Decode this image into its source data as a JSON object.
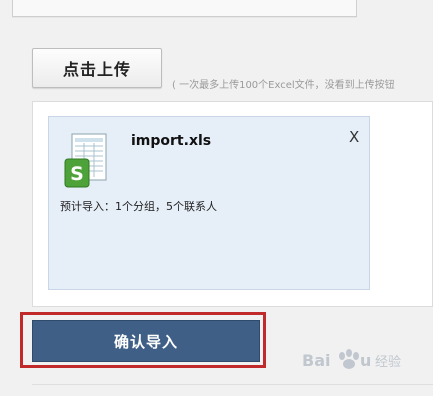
{
  "upload": {
    "button_label": "点击上传",
    "hint": "( 一次最多上传100个Excel文件，没看到上传按钮"
  },
  "file": {
    "name": "import.xls",
    "close_label": "X",
    "summary": "预计导入：1个分组，5个联系人",
    "icon": "spreadsheet-s-icon"
  },
  "actions": {
    "confirm_label": "确认导入"
  },
  "colors": {
    "confirm_bg": "#3f5f86",
    "highlight_border": "#c12a2a",
    "card_bg": "#e6eef8"
  },
  "watermark": {
    "brand": "Baidu 经验",
    "icon": "baidu-paw-icon"
  }
}
